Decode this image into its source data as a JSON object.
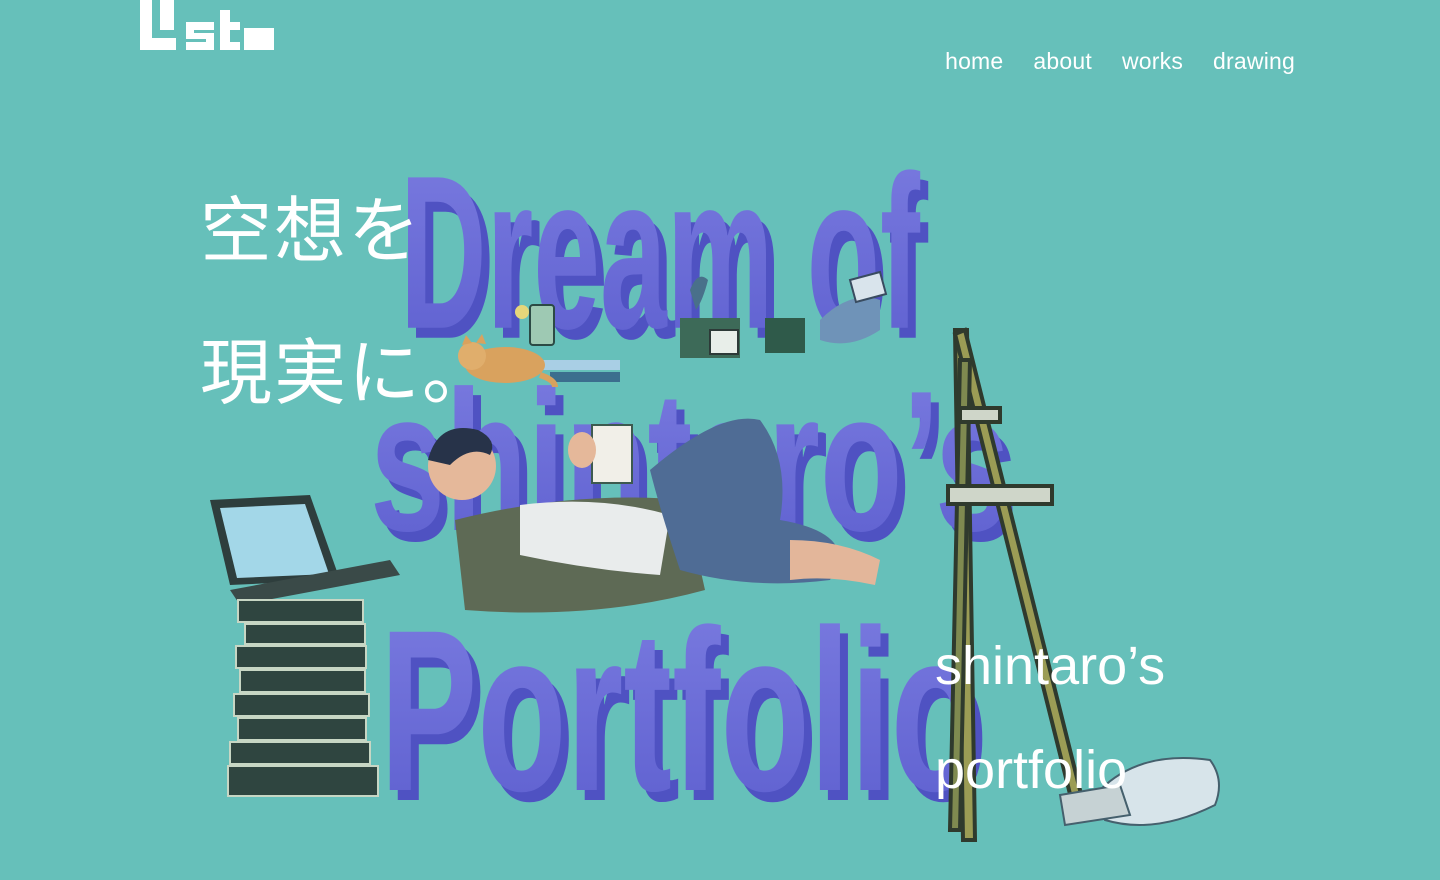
{
  "nav": {
    "home": "home",
    "about": "about",
    "works": "works",
    "drawing": "drawing"
  },
  "hero": {
    "tagline_line1": "空想を",
    "tagline_line2": "現実に。",
    "title_line1": "shintaro’s",
    "title_line2": "portfolio"
  },
  "artwork": {
    "word1": "Dream of",
    "word2": "shintaro’s",
    "word3": "Portfolio"
  },
  "colors": {
    "background": "#66c0ba",
    "accent_purple": "#6f6fd8",
    "text": "#ffffff"
  }
}
